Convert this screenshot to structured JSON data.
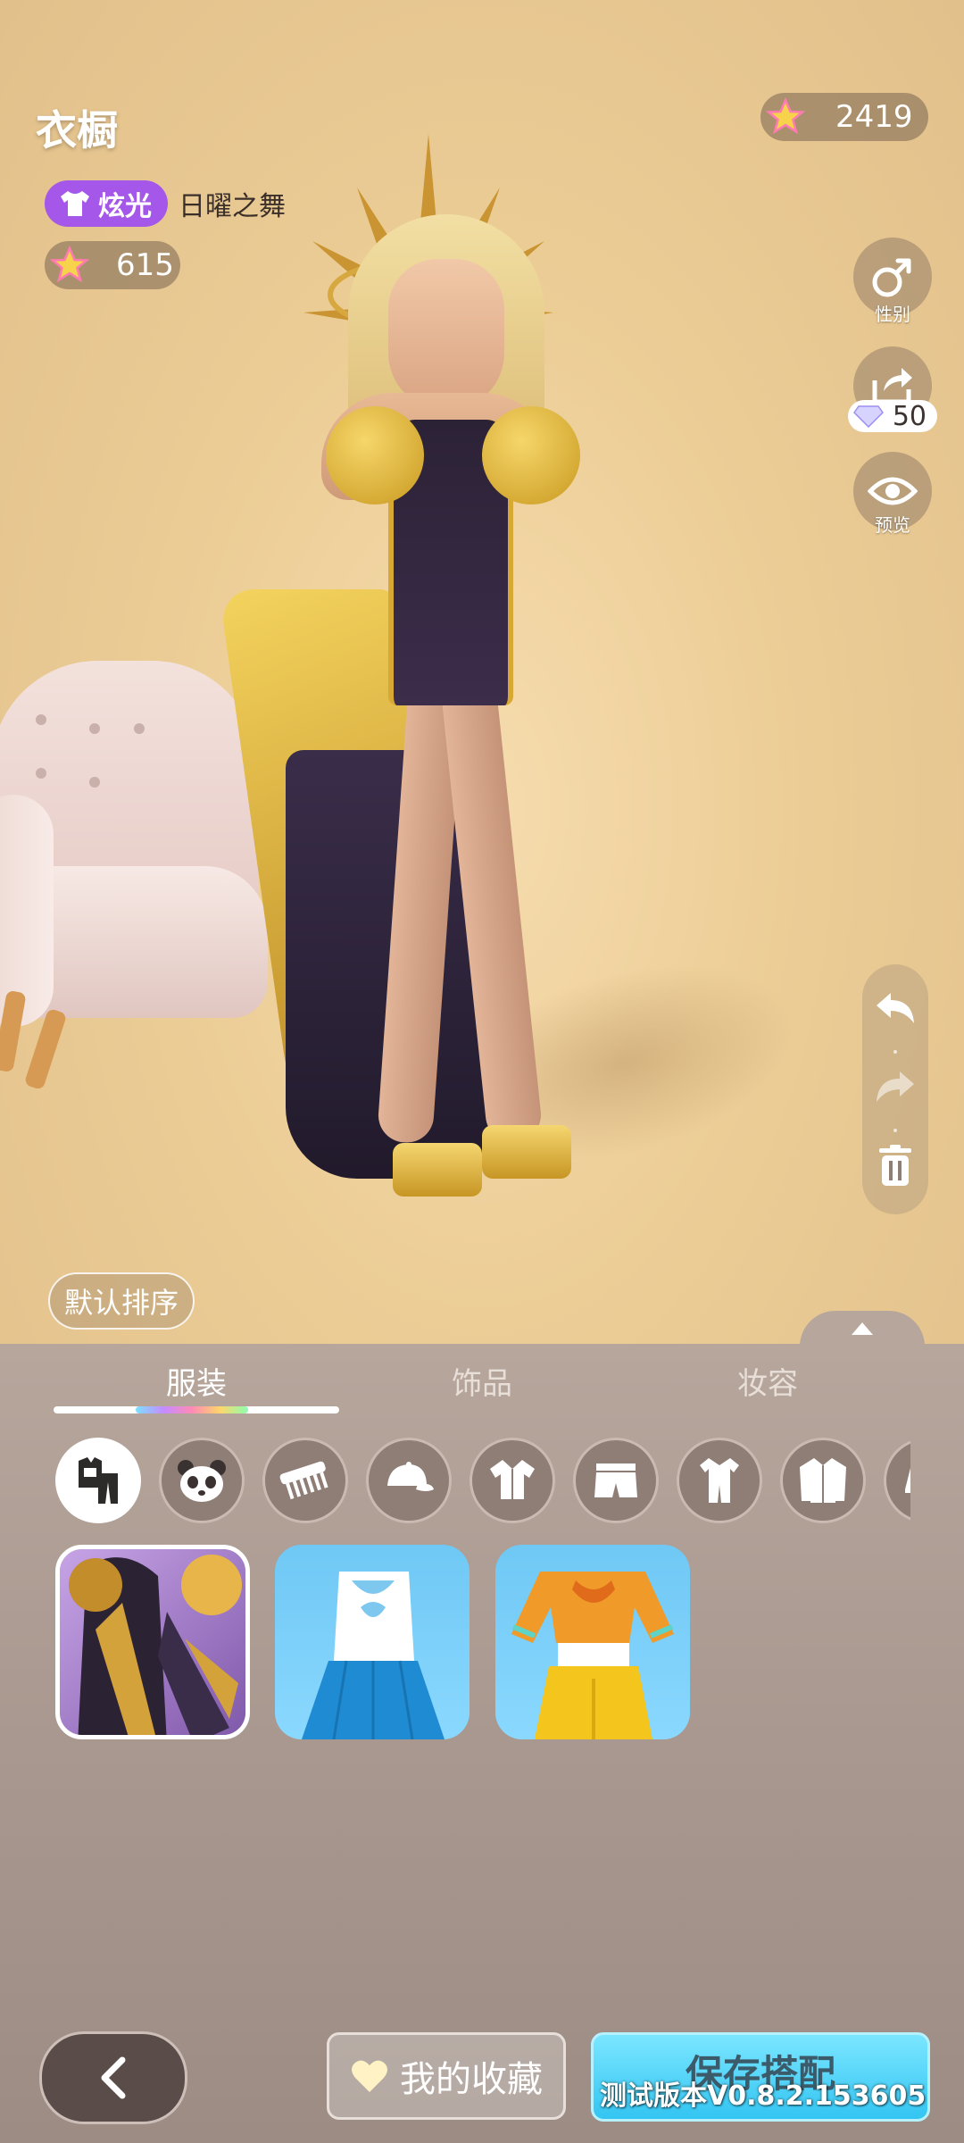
{
  "header": {
    "title": "衣橱",
    "currency_amount": "2419"
  },
  "costume": {
    "tag_label": "炫光",
    "name": "日曜之舞",
    "star_value": "615"
  },
  "side_tools": {
    "gender_label": "性别",
    "share_cost": "50",
    "preview_label": "预览"
  },
  "sort_button": "默认排序",
  "tabs": [
    {
      "label": "服装",
      "active": true
    },
    {
      "label": "饰品",
      "active": false
    },
    {
      "label": "妆容",
      "active": false
    }
  ],
  "categories": [
    {
      "icon": "outfit-set-icon",
      "active": true
    },
    {
      "icon": "panda-face-icon",
      "active": false
    },
    {
      "icon": "comb-icon",
      "active": false
    },
    {
      "icon": "cap-icon",
      "active": false
    },
    {
      "icon": "shirt-icon",
      "active": false
    },
    {
      "icon": "shorts-icon",
      "active": false
    },
    {
      "icon": "jumpsuit-icon",
      "active": false
    },
    {
      "icon": "jacket-icon",
      "active": false
    },
    {
      "icon": "shoe-icon",
      "active": false
    }
  ],
  "items": [
    {
      "name": "golden-purple-gown",
      "selected": true
    },
    {
      "name": "blue-skirt-outfit",
      "selected": false
    },
    {
      "name": "orange-yellow-outfit",
      "selected": false
    }
  ],
  "actions": {
    "favorites_label": "我的收藏",
    "save_label": "保存搭配"
  },
  "version_text": "测试版本V0.8.2.153605",
  "colors": {
    "accent_purple": "#a457e8",
    "save_blue": "#33c5f2",
    "panel_bg": "#a8988f"
  }
}
